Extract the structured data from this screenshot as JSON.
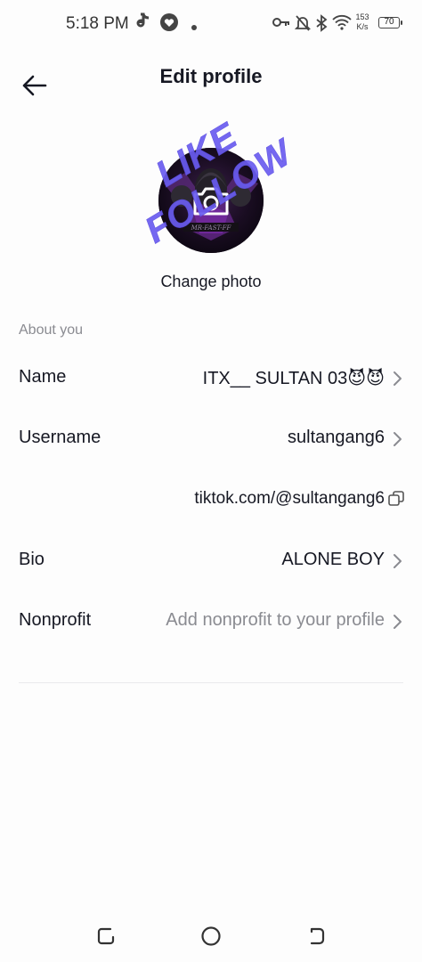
{
  "status_bar": {
    "time": "5:18 PM",
    "speed_value": "153",
    "speed_unit": "K/s",
    "battery": "70"
  },
  "header": {
    "title": "Edit profile"
  },
  "watermark": "LIKE FOLLOW",
  "avatar": {
    "caption": "MR-FAST-FF",
    "change_photo_label": "Change photo"
  },
  "about": {
    "section_label": "About you",
    "name": {
      "label": "Name",
      "value": "ITX__ SULTAN 03😈😈"
    },
    "username": {
      "label": "Username",
      "value": "sultangang6"
    },
    "link": "tiktok.com/@sultangang6",
    "bio": {
      "label": "Bio",
      "value": "ALONE BOY"
    },
    "nonprofit": {
      "label": "Nonprofit",
      "placeholder": "Add nonprofit to your profile"
    }
  },
  "colors": {
    "text": "#161823",
    "secondary": "#8a8b91",
    "watermark": "#6a5cf0"
  }
}
